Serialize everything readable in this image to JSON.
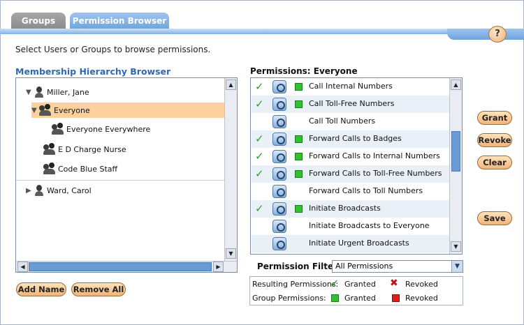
{
  "tabs": [
    {
      "label": "Groups",
      "active": false
    },
    {
      "label": "Permission Browser",
      "active": true
    }
  ],
  "help_label": "?",
  "instruction": "Select Users or Groups to browse permissions.",
  "membership": {
    "title": "Membership Hierarchy Browser",
    "items": [
      {
        "label": "Miller, Jane",
        "type": "user",
        "expanded": true
      },
      {
        "label": "Everyone",
        "type": "group",
        "expanded": true,
        "selected": true
      },
      {
        "label": "Everyone Everywhere",
        "type": "group"
      },
      {
        "label": "E D Charge Nurse",
        "type": "group"
      },
      {
        "label": "Code Blue Staff",
        "type": "group"
      },
      {
        "label": "Ward, Carol",
        "type": "user",
        "expanded": false
      }
    ],
    "add_name": "Add Name",
    "remove_all": "Remove All"
  },
  "permissions": {
    "title": "Permissions: Everyone",
    "items": [
      {
        "label": "Call Internal Numbers",
        "granted": true,
        "group": true
      },
      {
        "label": "Call Toll-Free Numbers",
        "granted": true,
        "group": true
      },
      {
        "label": "Call Toll Numbers",
        "granted": false,
        "group": false
      },
      {
        "label": "Forward Calls to Badges",
        "granted": true,
        "group": true
      },
      {
        "label": "Forward Calls to Internal Numbers",
        "granted": true,
        "group": true
      },
      {
        "label": "Forward Calls to Toll-Free Numbers",
        "granted": true,
        "group": true
      },
      {
        "label": "Forward Calls to Toll Numbers",
        "granted": false,
        "group": false
      },
      {
        "label": "Initiate Broadcasts",
        "granted": true,
        "group": true
      },
      {
        "label": "Initiate Broadcasts to Everyone",
        "granted": false,
        "group": false
      },
      {
        "label": "Initiate Urgent Broadcasts",
        "granted": false,
        "group": false
      }
    ]
  },
  "filter": {
    "label": "Permission Filter",
    "selected": "All Permissions"
  },
  "legend": {
    "resulting_label": "Resulting Permissions:",
    "group_label": "Group Permissions:",
    "granted": "Granted",
    "revoked": "Revoked"
  },
  "actions": {
    "grant": "Grant",
    "revoke": "Revoke",
    "clear": "Clear",
    "save": "Save"
  },
  "colors": {
    "accent": "#2f68b5",
    "selected_row": "#fcd19c",
    "granted_green": "#2fc12f",
    "revoked_red": "#e01b1b"
  }
}
